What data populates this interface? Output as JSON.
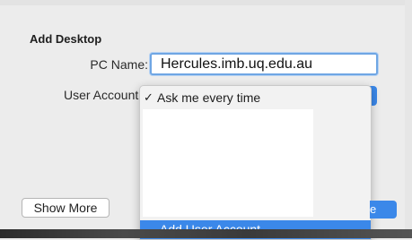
{
  "dialog": {
    "section_title": "Add Desktop",
    "pc_name_label": "PC Name:",
    "pc_name_value": "Hercules.imb.uq.edu.au",
    "user_account_label": "User Account"
  },
  "user_account_menu": {
    "selected_check": "✓",
    "items": [
      {
        "label": "Ask me every time",
        "selected": true
      },
      {
        "label": "Add User Account...",
        "highlighted": true
      }
    ]
  },
  "buttons": {
    "show_more": "Show More",
    "primary_partial": "e"
  },
  "colors": {
    "accent": "#3b88e9",
    "focus_ring": "#6fa6e4",
    "background": "#ececec"
  }
}
